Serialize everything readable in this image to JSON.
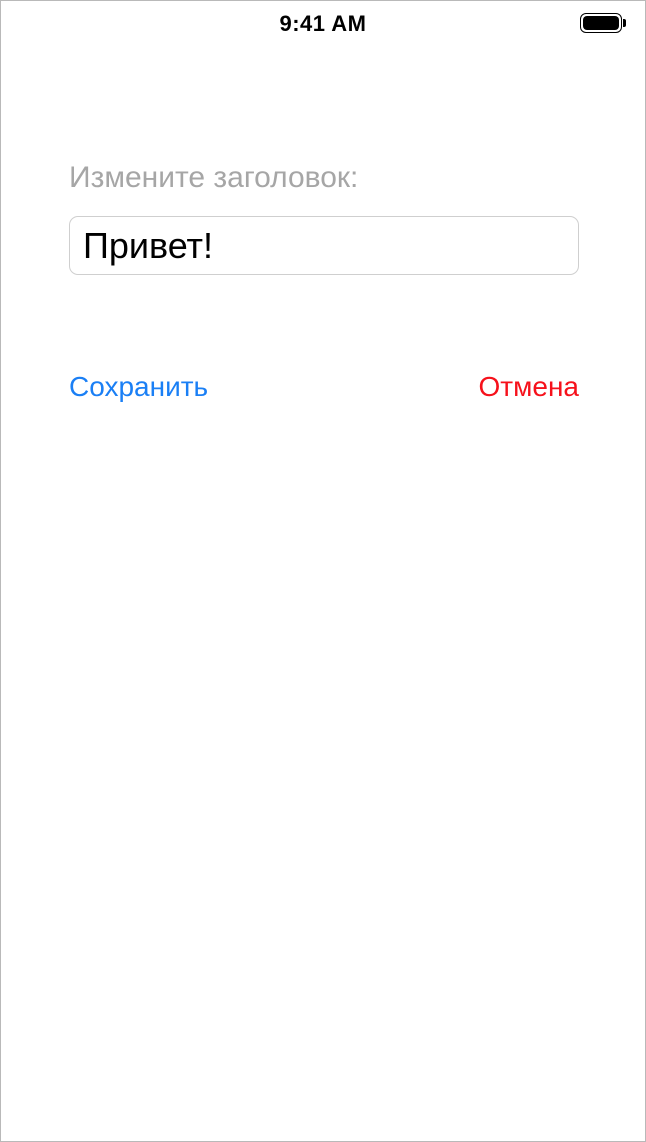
{
  "status_bar": {
    "time": "9:41 AM",
    "battery_icon": "battery-full-icon",
    "battery_level": 1.0
  },
  "form": {
    "prompt_label": "Измените заголовок:",
    "title_value": "Привет!"
  },
  "actions": {
    "save_label": "Сохранить",
    "cancel_label": "Отмена"
  },
  "colors": {
    "save": "#1a7ff5",
    "cancel": "#f6111b",
    "label": "#a6a6a6",
    "field_border": "#cfcfcf"
  }
}
